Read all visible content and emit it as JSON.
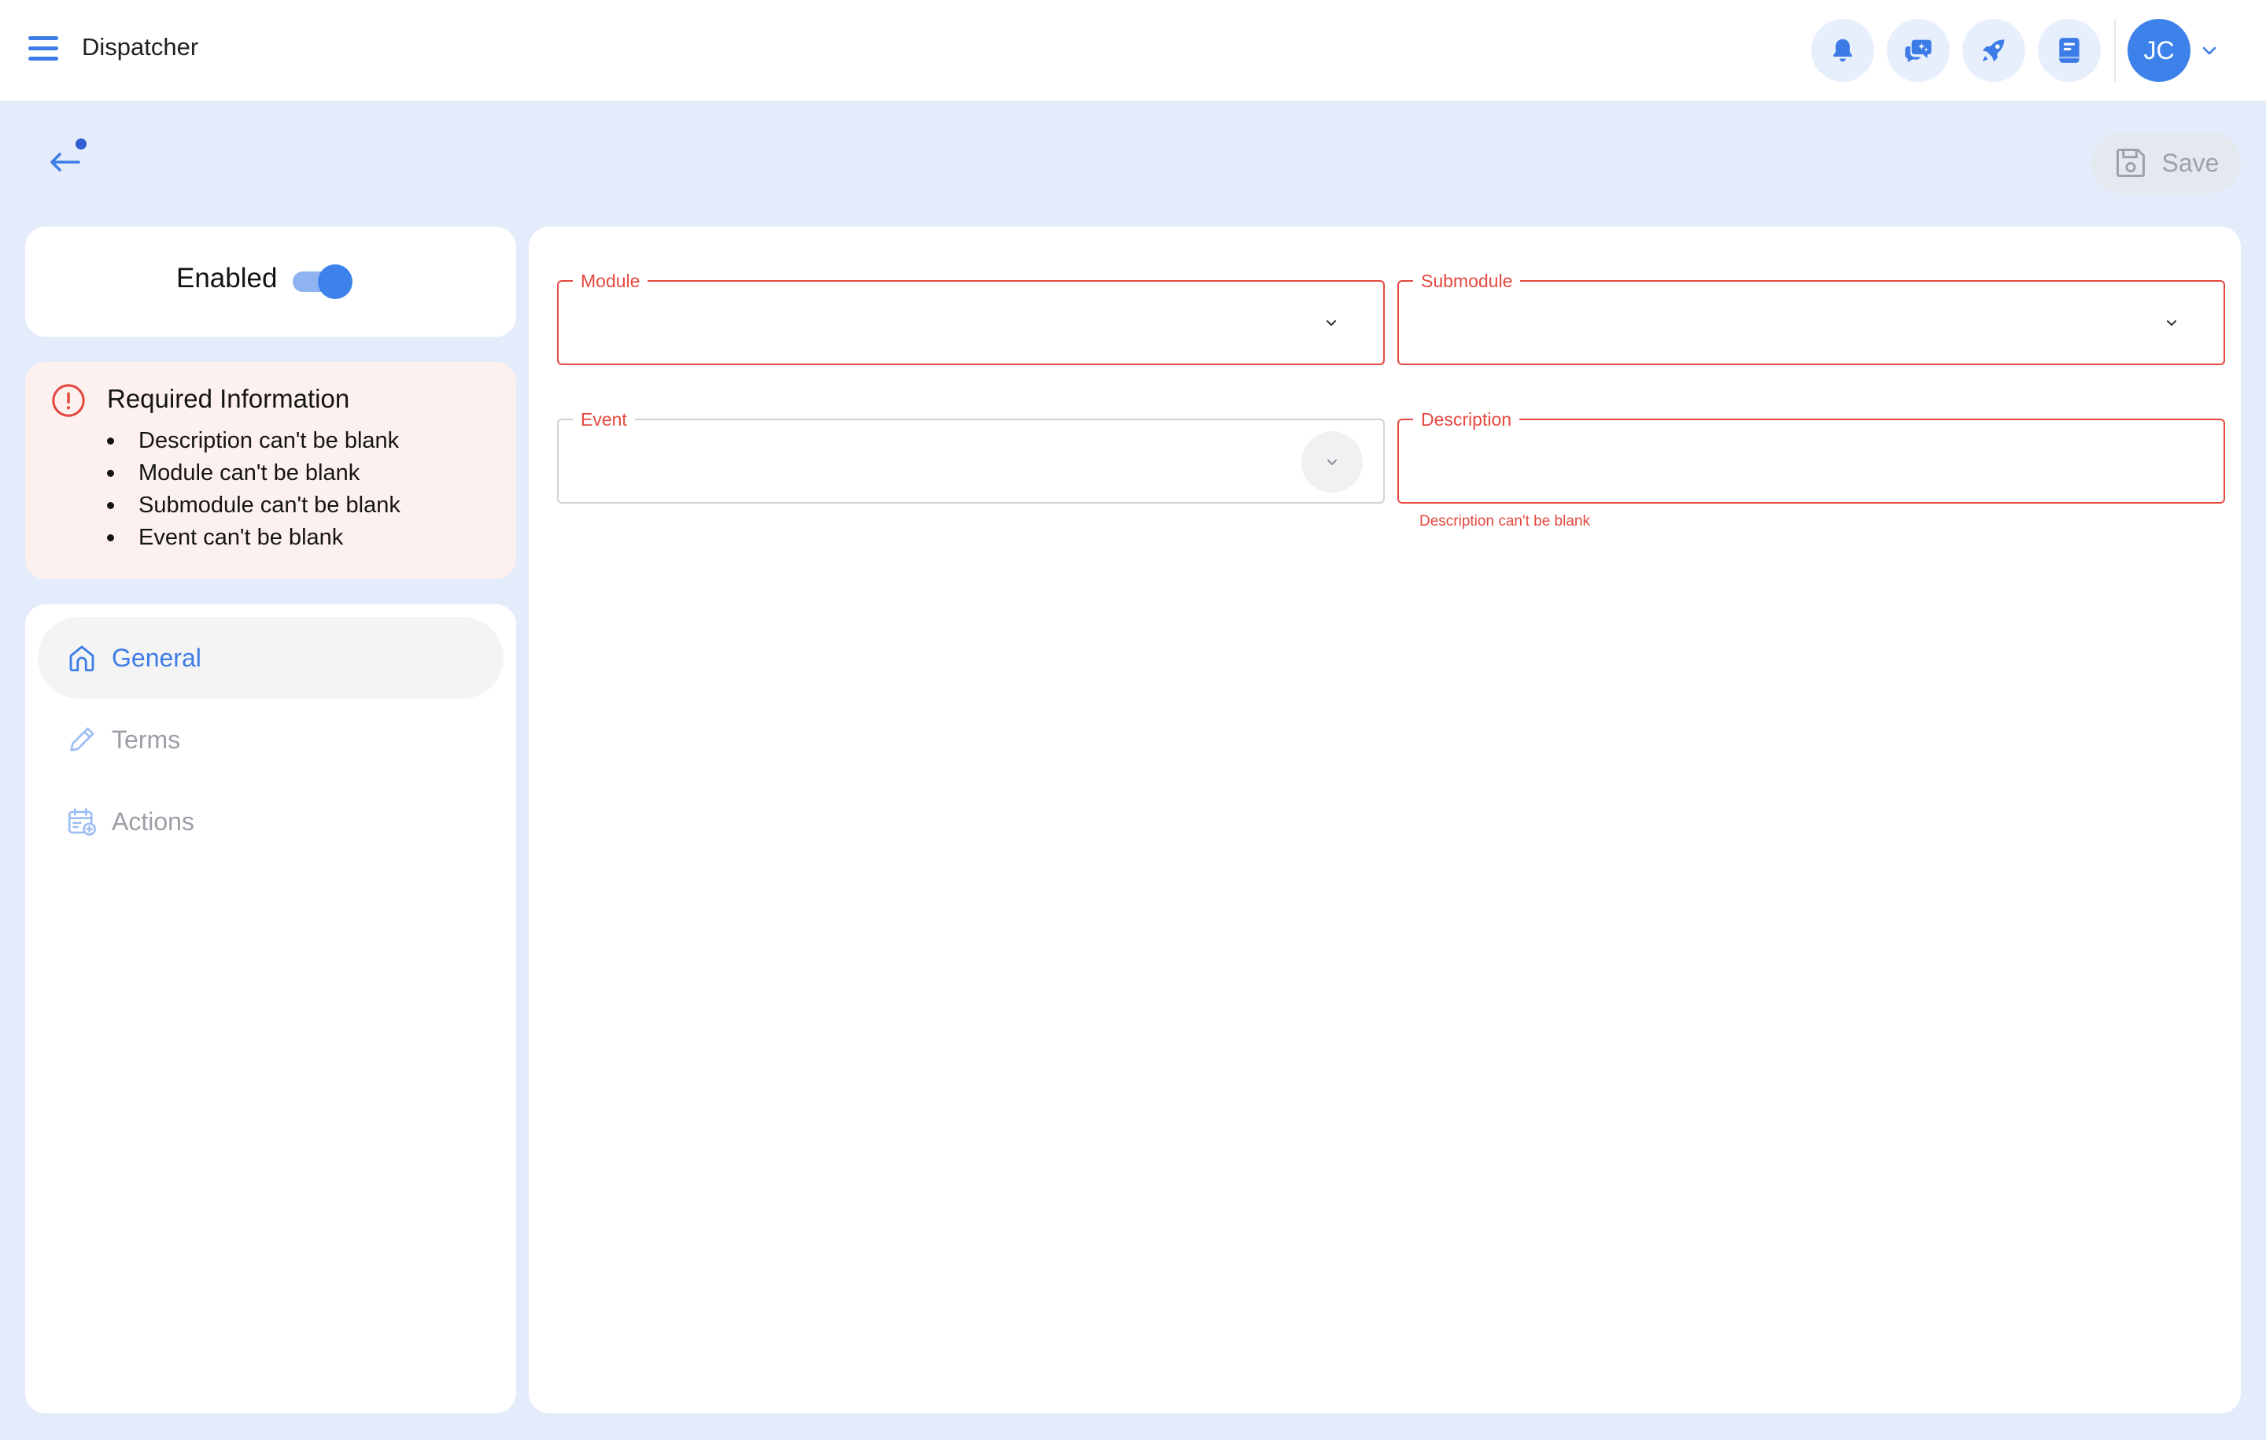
{
  "app": {
    "title": "Dispatcher"
  },
  "header": {
    "icons": [
      "bell-icon",
      "chat-sparkle-icon",
      "rocket-icon",
      "book-icon"
    ],
    "user_initials": "JC"
  },
  "toolbar": {
    "save_label": "Save"
  },
  "status": {
    "enabled_label": "Enabled",
    "enabled": true
  },
  "alert": {
    "title": "Required Information",
    "items": [
      "Description can't be blank",
      "Module can't be blank",
      "Submodule can't be blank",
      "Event can't be blank"
    ]
  },
  "nav": {
    "items": [
      {
        "label": "General",
        "icon": "home-icon",
        "active": true
      },
      {
        "label": "Terms",
        "icon": "pencil-icon",
        "active": false
      },
      {
        "label": "Actions",
        "icon": "calendar-add-icon",
        "active": false
      }
    ]
  },
  "form": {
    "module": {
      "label": "Module",
      "value": ""
    },
    "submodule": {
      "label": "Submodule",
      "value": ""
    },
    "event": {
      "label": "Event",
      "value": ""
    },
    "description": {
      "label": "Description",
      "value": "",
      "error": "Description can't be blank"
    }
  },
  "colors": {
    "accent": "#3d82ea",
    "error": "#e4483f",
    "background": "#e4ecfb",
    "alert_background": "#fdf1ef"
  }
}
